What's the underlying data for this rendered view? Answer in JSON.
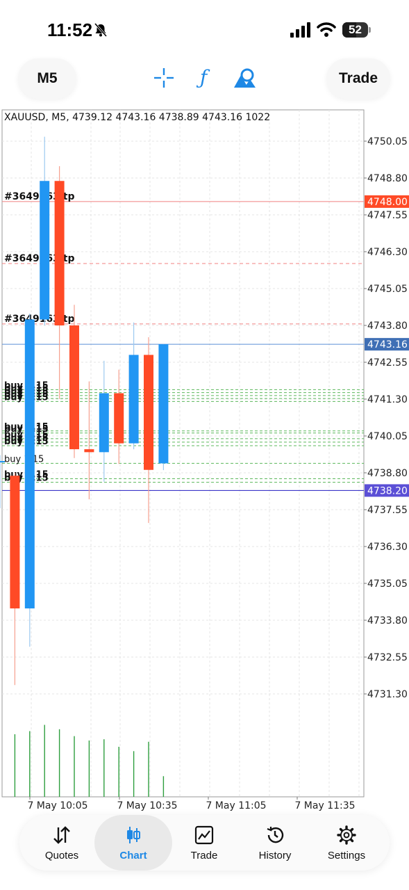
{
  "status_bar": {
    "time": "11:52",
    "battery": "52"
  },
  "toolbar": {
    "timeframe_label": "M5",
    "trade_label": "Trade",
    "crosshair_icon": "crosshair-icon",
    "indicators_icon": "function-icon",
    "objects_icon": "shapes-icon"
  },
  "chart": {
    "info_line": "XAUUSD, M5, 4739.12 4743.16 4738.89 4743.16 1022",
    "colors": {
      "bull": "#2196f3",
      "bear": "#ff4a26",
      "grid": "#e4e4e4",
      "volume": "#2e9e3e",
      "tp_line": "#f08080",
      "buy_line": "#5cb85c",
      "bid_line": "#5a8fd6",
      "ask_line": "#3b35c9"
    }
  },
  "chart_data": {
    "type": "candlestick",
    "symbol": "XAUUSD",
    "timeframe": "M5",
    "y_ticks": [
      "4750.05",
      "4748.80",
      "4747.55",
      "4746.30",
      "4745.05",
      "4743.80",
      "4742.55",
      "4741.30",
      "4740.05",
      "4738.80",
      "4737.55",
      "4736.30",
      "4735.05",
      "4733.80",
      "4732.55",
      "4731.30"
    ],
    "ylim": [
      4731.0,
      4750.6
    ],
    "x_labels": [
      "7 May 10:05",
      "7 May 10:35",
      "7 May 11:05",
      "7 May 11:35"
    ],
    "price_tags": [
      {
        "text": "4748.00",
        "value": 4748.0,
        "color": "#ff4a26"
      },
      {
        "text": "4743.16",
        "value": 4743.16,
        "color": "#3f6fb5"
      },
      {
        "text": "4738.20",
        "value": 4738.2,
        "color": "#5b4fd6"
      }
    ],
    "candles": [
      {
        "o": 4739.2,
        "h": 4739.4,
        "l": 4737.6,
        "c": 4739.2
      },
      {
        "o": 4738.7,
        "h": 4738.8,
        "l": 4731.6,
        "c": 4734.2
      },
      {
        "o": 4734.2,
        "h": 4744.2,
        "l": 4732.9,
        "c": 4744.0
      },
      {
        "o": 4744.0,
        "h": 4750.2,
        "l": 4743.8,
        "c": 4748.7
      },
      {
        "o": 4748.7,
        "h": 4749.2,
        "l": 4741.3,
        "c": 4743.8
      },
      {
        "o": 4743.8,
        "h": 4744.5,
        "l": 4739.3,
        "c": 4739.6
      },
      {
        "o": 4739.6,
        "h": 4741.9,
        "l": 4737.9,
        "c": 4739.5
      },
      {
        "o": 4739.5,
        "h": 4742.6,
        "l": 4738.5,
        "c": 4741.5
      },
      {
        "o": 4741.5,
        "h": 4742.3,
        "l": 4739.1,
        "c": 4739.8
      },
      {
        "o": 4739.8,
        "h": 4743.9,
        "l": 4739.6,
        "c": 4742.8
      },
      {
        "o": 4742.8,
        "h": 4743.4,
        "l": 4737.1,
        "c": 4738.9
      },
      {
        "o": 4739.12,
        "h": 4743.16,
        "l": 4738.89,
        "c": 4743.16
      }
    ],
    "volumes": [
      0,
      1.0,
      1.05,
      1.15,
      1.08,
      0.97,
      0.9,
      0.92,
      0.8,
      0.73,
      0.88,
      0.33
    ],
    "tp_lines": [
      {
        "label": "#3649163 tp",
        "value": 4748.0,
        "style": "solid"
      },
      {
        "label": "#3649163 tp",
        "value": 4745.9,
        "style": "dashed"
      },
      {
        "label": "#3649163 tp",
        "value": 4743.85,
        "style": "dashed"
      }
    ],
    "buy_lines": [
      {
        "label": "buy 1.15",
        "value": 4741.62
      },
      {
        "label": "buy 1.15",
        "value": 4741.52
      },
      {
        "label": "buy 1.15",
        "value": 4741.42
      },
      {
        "label": "buy 1.15",
        "value": 4741.32
      },
      {
        "label": "buy 1.15",
        "value": 4741.22
      },
      {
        "label": "buy 1.15",
        "value": 4740.22
      },
      {
        "label": "buy 1.15",
        "value": 4740.15
      },
      {
        "label": "buy 1.15",
        "value": 4739.96
      },
      {
        "label": "buy 1.15",
        "value": 4739.84
      },
      {
        "label": "buy 1.15",
        "value": 4739.72
      },
      {
        "label": "buy 1.15",
        "value": 4739.12
      },
      {
        "label": "buy 1.15",
        "value": 4738.6
      },
      {
        "label": "buy 1.15",
        "value": 4738.48
      }
    ],
    "bid_line": 4743.16,
    "ask_line": 4738.2
  },
  "tabs": [
    {
      "label": "Quotes",
      "icon": "arrows-updown-icon",
      "active": false
    },
    {
      "label": "Chart",
      "icon": "candles-icon",
      "active": true
    },
    {
      "label": "Trade",
      "icon": "trend-icon",
      "active": false
    },
    {
      "label": "History",
      "icon": "history-icon",
      "active": false
    },
    {
      "label": "Settings",
      "icon": "gear-icon",
      "active": false
    }
  ]
}
